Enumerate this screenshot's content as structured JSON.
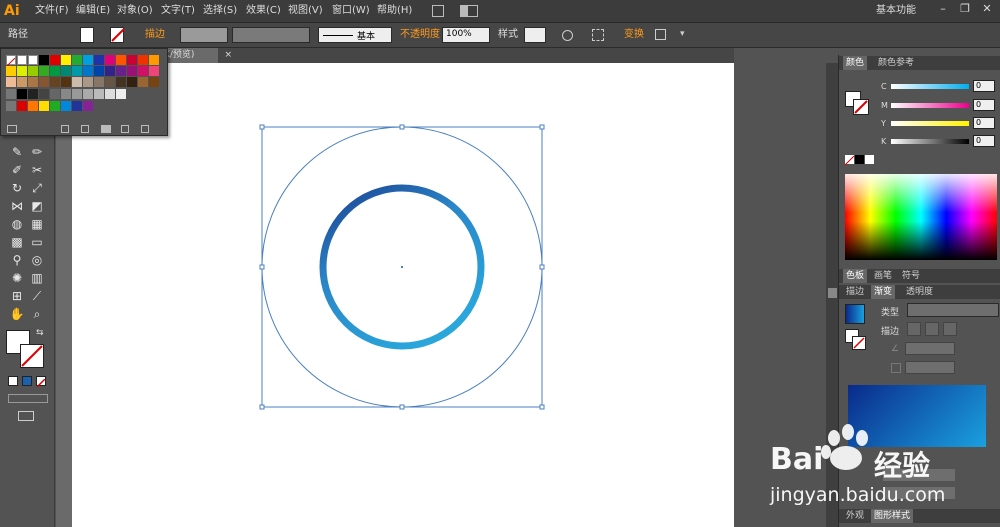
{
  "app": {
    "logo": "Ai"
  },
  "menu": [
    "文件(F)",
    "编辑(E)",
    "对象(O)",
    "文字(T)",
    "选择(S)",
    "效果(C)",
    "视图(V)",
    "窗口(W)",
    "帮助(H)"
  ],
  "workspace": "基本功能",
  "window_controls": {
    "minimize": "–",
    "restore": "❐",
    "close": "✕"
  },
  "control_bar": {
    "selection_label": "路径",
    "stroke_label": "描边",
    "stroke_style": "基本",
    "opacity_label": "不透明度",
    "opacity_value": "100%",
    "style_label": "样式",
    "transform_label": "变换"
  },
  "document_tab": {
    "title": "K/预览)",
    "close": "×"
  },
  "color_panel": {
    "tabs": [
      "颜色",
      "颜色参考"
    ],
    "channels": [
      {
        "label": "C",
        "value": "0"
      },
      {
        "label": "M",
        "value": "0"
      },
      {
        "label": "Y",
        "value": "0"
      },
      {
        "label": "K",
        "value": "0"
      }
    ]
  },
  "swatch_tabs": [
    "色板",
    "画笔",
    "符号"
  ],
  "gradient_panel": {
    "tabs": [
      "描边",
      "渐变",
      "透明度"
    ],
    "type_label": "类型",
    "stroke_label": "描边",
    "gradient_start": "#0a2a8a",
    "gradient_end": "#1aa0e0"
  },
  "bottom_tabs": [
    "外观",
    "图形样式"
  ],
  "watermark": {
    "brand": "Bai",
    "brand2": "经验",
    "url": "jingyan.baidu.com"
  },
  "colors": {
    "ring_dark": "#1b3f8f",
    "ring_light": "#2aa6db",
    "selection": "#4a7fc1"
  }
}
